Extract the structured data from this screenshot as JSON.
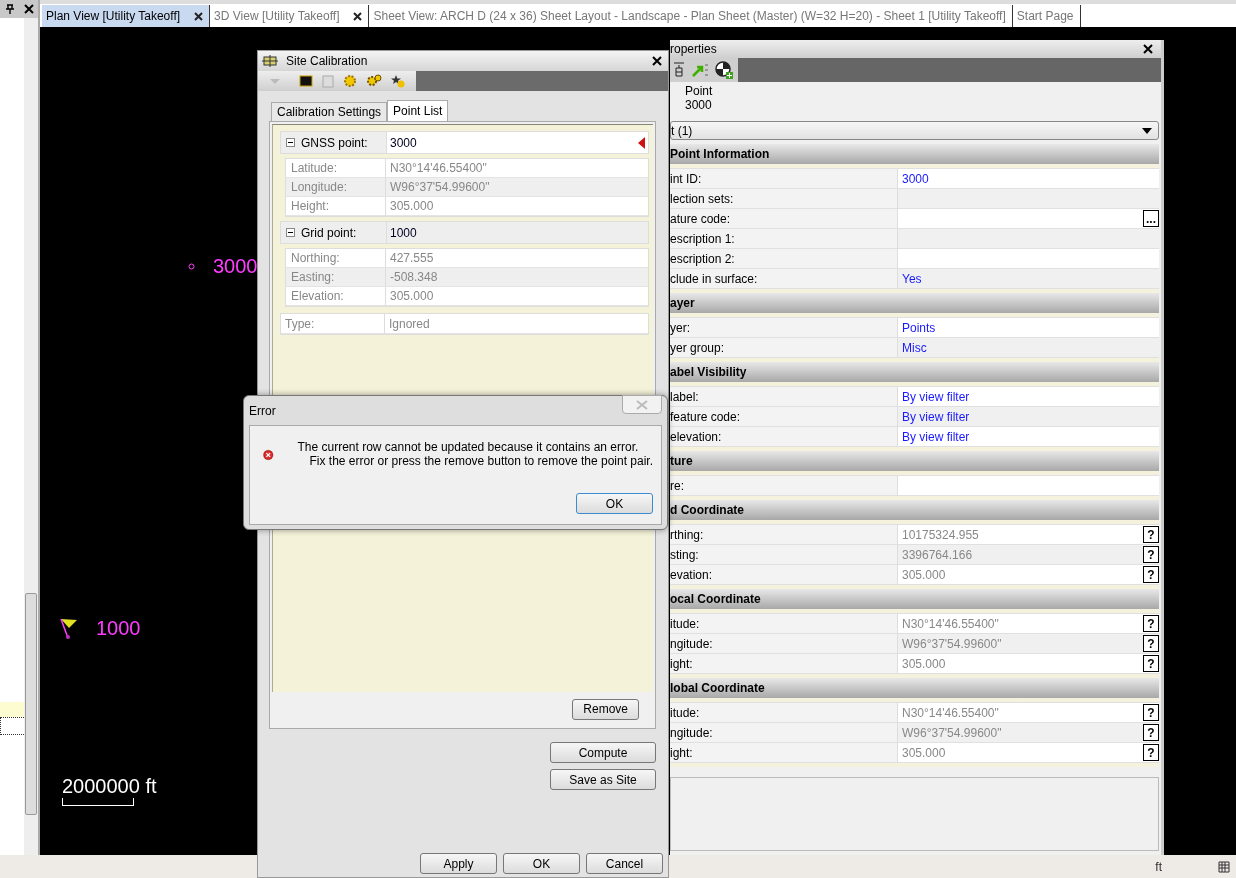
{
  "tabs": [
    {
      "label": "Plan View [Utility Takeoff]",
      "selected": true,
      "closable": true
    },
    {
      "label": "3D View [Utility Takeoff]",
      "selected": false,
      "closable": true
    },
    {
      "label": "Sheet View: ARCH D (24 x 36) Sheet Layout - Landscape - Plan Sheet (Master) (W=32 H=20) - Sheet 1 [Utility Takeoff]",
      "selected": false,
      "closable": false
    },
    {
      "label": "Start Page",
      "selected": false,
      "closable": false
    }
  ],
  "canvas": {
    "points": [
      {
        "label": "3000",
        "kind": "circle"
      },
      {
        "label": "1000",
        "kind": "flag"
      }
    ],
    "scale": "2000000 ft"
  },
  "site_calibration": {
    "title": "Site Calibration",
    "tabs": [
      {
        "label": "Calibration Settings",
        "selected": false
      },
      {
        "label": "Point List",
        "selected": true
      }
    ],
    "groups": [
      {
        "label": "GNSS point:",
        "value": "3000",
        "expanded": true,
        "error": true,
        "fields": [
          {
            "label": "Latitude:",
            "value": "N30°14'46.55400\""
          },
          {
            "label": "Longitude:",
            "value": "W96°37'54.99600\""
          },
          {
            "label": "Height:",
            "value": "305.000"
          }
        ]
      },
      {
        "label": "Grid point:",
        "value": "1000",
        "expanded": true,
        "error": false,
        "fields": [
          {
            "label": "Northing:",
            "value": "427.555"
          },
          {
            "label": "Easting:",
            "value": "-508.348"
          },
          {
            "label": "Elevation:",
            "value": "305.000"
          }
        ]
      }
    ],
    "type_row": {
      "label": "Type:",
      "value": "Ignored"
    },
    "remove_button": "Remove",
    "compute_button": "Compute",
    "save_button": "Save as Site",
    "footer_buttons": [
      "Apply",
      "OK",
      "Cancel"
    ]
  },
  "properties": {
    "title": "roperties",
    "object_type": "Point",
    "object_id": "3000",
    "selector": "t (1)",
    "sections": [
      {
        "title": "Point Information",
        "rows": [
          {
            "label": "int ID:",
            "value": "3000",
            "kind": "editable"
          },
          {
            "label": "lection sets:",
            "kind": "readonly"
          },
          {
            "label": "ature code:",
            "kind": "editable",
            "button": "..."
          },
          {
            "label": "escription 1:",
            "kind": "readonly"
          },
          {
            "label": "escription 2:",
            "kind": "editable"
          },
          {
            "label": "clude in surface:",
            "value": "Yes",
            "kind": "editable"
          }
        ]
      },
      {
        "title": "ayer",
        "rows": [
          {
            "label": "yer:",
            "value": "Points",
            "kind": "editable"
          },
          {
            "label": "yer group:",
            "value": "Misc",
            "kind": "editable"
          }
        ]
      },
      {
        "title": "abel Visibility",
        "rows": [
          {
            "label": "label:",
            "value": "By view filter",
            "kind": "editable"
          },
          {
            "label": "feature code:",
            "value": "By view filter",
            "kind": "editable"
          },
          {
            "label": "elevation:",
            "value": "By view filter",
            "kind": "editable"
          }
        ]
      },
      {
        "title": "ture",
        "rows": [
          {
            "label": "re:",
            "kind": "editable"
          }
        ]
      },
      {
        "title": "d Coordinate",
        "rows": [
          {
            "label": "rthing:",
            "value": "10175324.955",
            "kind": "readonly",
            "button": "?"
          },
          {
            "label": "sting:",
            "value": "3396764.166",
            "kind": "readonly",
            "button": "?"
          },
          {
            "label": "evation:",
            "value": "305.000",
            "kind": "readonly",
            "button": "?"
          }
        ]
      },
      {
        "title": "ocal Coordinate",
        "rows": [
          {
            "label": "itude:",
            "value": "N30°14'46.55400\"",
            "kind": "readonly",
            "button": "?"
          },
          {
            "label": "ngitude:",
            "value": "W96°37'54.99600\"",
            "kind": "readonly",
            "button": "?"
          },
          {
            "label": "ight:",
            "value": "305.000",
            "kind": "readonly",
            "button": "?"
          }
        ]
      },
      {
        "title": "lobal Coordinate",
        "rows": [
          {
            "label": "itude:",
            "value": "N30°14'46.55400\"",
            "kind": "readonly",
            "button": "?"
          },
          {
            "label": "ngitude:",
            "value": "W96°37'54.99600\"",
            "kind": "readonly",
            "button": "?"
          },
          {
            "label": "ight:",
            "value": "305.000",
            "kind": "readonly",
            "button": "?"
          }
        ]
      }
    ]
  },
  "error_dialog": {
    "title": "Error",
    "message_lines": [
      "The current row cannot be updated because it contains an error.",
      "Fix the error or press the remove button to remove the point pair."
    ],
    "button": "OK"
  },
  "status_bar": {
    "unit": "ft"
  }
}
